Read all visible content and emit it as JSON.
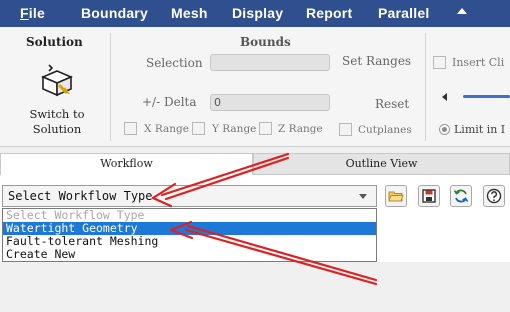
{
  "menubar": {
    "file_label": "File",
    "file_first": "F",
    "file_rest": "ile",
    "boundary_label": "Boundary",
    "mesh_label": "Mesh",
    "display_label": "Display",
    "report_label": "Report",
    "parallel_label": "Parallel",
    "bg_color": "#2f4f8f"
  },
  "ribbon": {
    "solution": {
      "title": "Solution",
      "switch_line1": "Switch to",
      "switch_line2": "Solution",
      "icon": "switch-to-solution-icon"
    },
    "bounds": {
      "title": "Bounds",
      "selection_label": "Selection",
      "selection_value": "",
      "delta_label": "+/- Delta",
      "delta_value": "0",
      "set_ranges_label": "Set Ranges",
      "reset_label": "Reset",
      "x_range_label": "X Range",
      "y_range_label": "Y Range",
      "z_range_label": "Z Range",
      "cutplanes_label": "Cutplanes"
    },
    "insert": {
      "insert_clip_label": "Insert Cli",
      "limit_label": "Limit in I"
    }
  },
  "tabs": {
    "workflow_label": "Workflow",
    "outline_label": "Outline View"
  },
  "workflow": {
    "select_value": "Select Workflow Type",
    "options": [
      {
        "label": "Select Workflow Type",
        "state": "disabled"
      },
      {
        "label": "Watertight Geometry",
        "state": "selected"
      },
      {
        "label": "Fault-tolerant Meshing",
        "state": "normal"
      },
      {
        "label": "Create New",
        "state": "normal"
      }
    ],
    "toolbar_icons": [
      "open-folder-icon",
      "save-icon",
      "refresh-icon",
      "help-icon"
    ]
  },
  "colors": {
    "accent_selected": "#1e78d7",
    "annotation_arrow": "#e02020"
  }
}
